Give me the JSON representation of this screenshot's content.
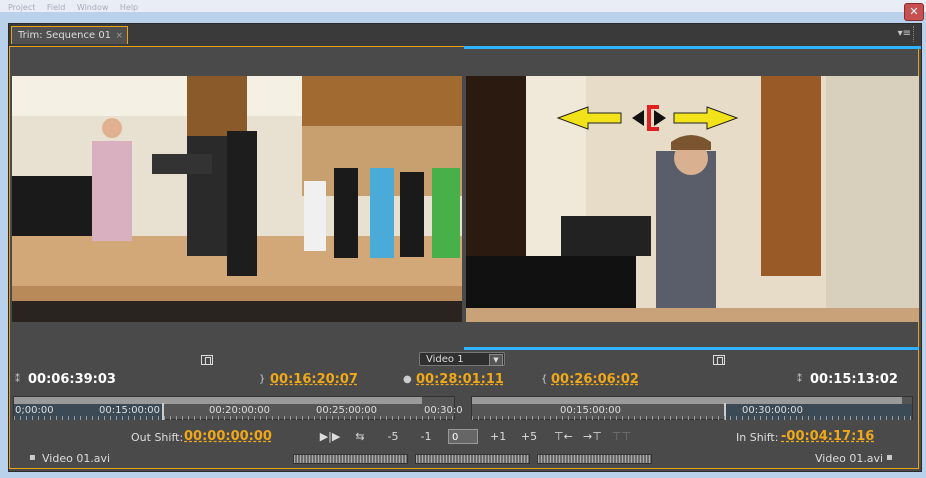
{
  "menu": {
    "items": [
      "Project",
      "Field",
      "Window",
      "Help"
    ]
  },
  "window": {
    "close_glyph": "✕"
  },
  "tab": {
    "title": "Trim: Sequence 01",
    "close_glyph": "×"
  },
  "panel": {
    "menu_glyph": "▾≡"
  },
  "monitor": {
    "track": "Video 1",
    "track_arrow": "▼",
    "outgoing_duration": "00:06:39:03",
    "out_point": "00:16:20:07",
    "sequence_time": "00:28:01:11",
    "in_point": "00:26:06:02",
    "incoming_duration": "00:15:13:02"
  },
  "ruler_left": {
    "labels": [
      "0;00:00",
      "00:15:00:00",
      "00:20:00:00",
      "00:25:00:00",
      "00:30:0"
    ]
  },
  "ruler_right": {
    "labels": [
      "00:15:00:00",
      "00:30:00:00"
    ]
  },
  "trim": {
    "out_shift_label": "Out Shift:",
    "out_shift_value": "00:00:00:00",
    "in_shift_label": "In Shift:",
    "in_shift_value": "-00:04:17:16",
    "buttons": [
      "▶|▶",
      "⇆",
      "-5",
      "-1",
      "+1",
      "+5"
    ],
    "field_value": "0"
  },
  "clips": {
    "left": "Video 01.avi",
    "right": "Video 01.avi"
  },
  "colors": {
    "accent": "#e8a317",
    "timecode": "#f0a818",
    "selection": "#2fb2ff",
    "trim_arrow": "#f2e21a"
  },
  "icons": [
    "safe-margin-icon",
    "trim-arrows-icon",
    "ripple-trim-icon",
    "sequence-marker-icon"
  ]
}
